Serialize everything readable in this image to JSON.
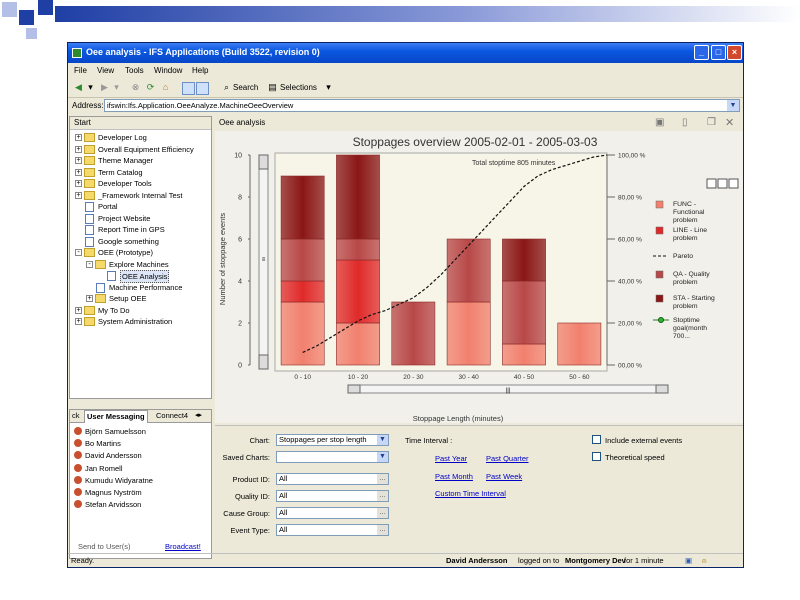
{
  "window": {
    "title": "Oee analysis - IFS Applications (Build 3522, revision 0)"
  },
  "menu": [
    "File",
    "View",
    "Tools",
    "Window",
    "Help"
  ],
  "toolbar": {
    "search_label": "Search",
    "selections_label": "Selections"
  },
  "address": {
    "label": "Address:",
    "value": "ifswin:Ifs.Application.OeeAnalyze.MachineOeeOverview"
  },
  "navigator": {
    "header": "Start",
    "items": [
      {
        "label": "Developer Log",
        "level": 0,
        "kind": "folder",
        "exp": "+"
      },
      {
        "label": "Overall Equipment Efficiency",
        "level": 0,
        "kind": "folder",
        "exp": "+"
      },
      {
        "label": "Theme Manager",
        "level": 0,
        "kind": "folder",
        "exp": "+"
      },
      {
        "label": "Term Catalog",
        "level": 0,
        "kind": "folder",
        "exp": "+"
      },
      {
        "label": "Developer Tools",
        "level": 0,
        "kind": "folder",
        "exp": "+"
      },
      {
        "label": "_Framework Internal Test",
        "level": 0,
        "kind": "folder",
        "exp": "+"
      },
      {
        "label": "Portal",
        "level": 0,
        "kind": "doc",
        "exp": ""
      },
      {
        "label": "Project Website",
        "level": 0,
        "kind": "doc",
        "exp": ""
      },
      {
        "label": "Report Time in GPS",
        "level": 0,
        "kind": "doc",
        "exp": ""
      },
      {
        "label": "Google something",
        "level": 0,
        "kind": "doc",
        "exp": ""
      },
      {
        "label": "OEE (Prototype)",
        "level": 0,
        "kind": "folder",
        "exp": "-"
      },
      {
        "label": "Explore Machines",
        "level": 1,
        "kind": "folder",
        "exp": "-"
      },
      {
        "label": "OEE Analysis",
        "level": 2,
        "kind": "doc",
        "exp": "",
        "selected": true
      },
      {
        "label": "Machine Performance",
        "level": 1,
        "kind": "doc",
        "exp": ""
      },
      {
        "label": "Setup OEE",
        "level": 1,
        "kind": "folder",
        "exp": "+"
      },
      {
        "label": "My To Do",
        "level": 0,
        "kind": "folder",
        "exp": "+"
      },
      {
        "label": "System Administration",
        "level": 0,
        "kind": "folder",
        "exp": "+"
      }
    ]
  },
  "messaging": {
    "tabs": [
      "ck",
      "User Messaging",
      "Connect4"
    ],
    "users": [
      "Björn Samuelsson",
      "Bo Martins",
      "David Andersson",
      "Jan Romell",
      "Kumudu Widyaratne",
      "Magnus Nyström",
      "Stefan Arvidsson"
    ],
    "send_to": "Send to User(s)",
    "broadcast": "Broadcast!"
  },
  "main": {
    "header": "Oee analysis"
  },
  "chart_data": {
    "type": "bar",
    "title": "Stoppages overview 2005-02-01 - 2005-03-03",
    "annotation": "Total stoptime 805 minutes",
    "xlabel": "Stoppage Length (minutes)",
    "ylabel": "Number of stoppage events",
    "ylim": [
      0,
      10
    ],
    "y_ticks": [
      "0",
      "2",
      "4",
      "6",
      "8",
      "10"
    ],
    "y2_ticks": [
      "00,00 %",
      "20,00 %",
      "40,00 %",
      "60,00 %",
      "80,00 %",
      "100,00 %"
    ],
    "categories": [
      "0 - 10",
      "10 - 20",
      "20 - 30",
      "30 - 40",
      "40 - 50",
      "50 - 60"
    ],
    "series": [
      {
        "name": "FUNC - Functional problem",
        "color": "#f2806e",
        "values": [
          3,
          2,
          0,
          3,
          1,
          2
        ]
      },
      {
        "name": "LINE - Line problem",
        "color": "#e02a2a",
        "values": [
          1,
          3,
          0,
          0,
          0,
          0
        ]
      },
      {
        "name": "QA - Quality problem",
        "color": "#b84848",
        "values": [
          2,
          1,
          3,
          3,
          3,
          0
        ]
      },
      {
        "name": "STA - Starting problem",
        "color": "#8a1616",
        "values": [
          3,
          4,
          0,
          0,
          2,
          0
        ]
      }
    ],
    "pareto": {
      "name": "Pareto",
      "x": [
        0,
        0.25,
        0.5,
        0.75,
        1,
        1.25,
        1.5,
        1.75,
        2,
        2.25,
        2.5,
        2.75,
        3,
        3.25,
        3.5,
        3.75,
        4,
        4.25,
        4.5,
        4.75,
        5,
        5.25,
        5.5
      ],
      "y_pct": [
        6,
        9,
        13,
        17,
        21,
        24,
        26,
        29,
        32,
        37,
        43,
        50,
        57,
        64,
        71,
        78,
        85,
        90,
        93,
        95,
        97,
        99,
        100
      ]
    },
    "goal": {
      "name": "Stoptime goal(month 700..."
    },
    "legend_position": "right"
  },
  "form": {
    "chart_label": "Chart:",
    "chart_value": "Stoppages per stop length",
    "saved_label": "Saved Charts:",
    "saved_value": "",
    "product_label": "Product ID:",
    "product_value": "All",
    "quality_label": "Quality ID:",
    "quality_value": "All",
    "cause_label": "Cause Group:",
    "cause_value": "All",
    "event_label": "Event Type:",
    "event_value": "All",
    "time_label": "Time Interval :",
    "past_year": "Past Year",
    "past_quarter": "Past Quarter",
    "past_month": "Past Month",
    "past_week": "Past Week",
    "custom": "Custom Time Interval",
    "include_external": "Include external events",
    "theoretical": "Theoretical speed"
  },
  "status": {
    "left": "Ready.",
    "user": "David Andersson",
    "mid": "logged on to",
    "db": "Montgomery Dev",
    "duration": "for 1 minute"
  },
  "colors": {
    "titlebar": "#0a58e0",
    "deco_blue": "#1f3fa5",
    "deco_light": "#b3bfe6"
  }
}
